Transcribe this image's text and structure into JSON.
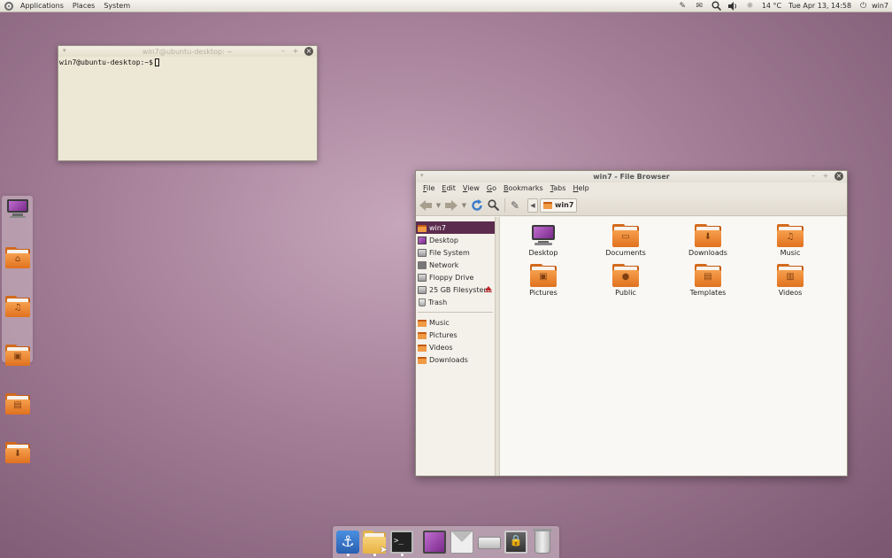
{
  "top_panel": {
    "menus": [
      "Applications",
      "Places",
      "System"
    ],
    "weather": "14 °C",
    "clock": "Tue Apr 13, 14:58",
    "user": "win7",
    "tray_icons": [
      "pencil-icon",
      "mail-icon",
      "search-icon",
      "volume-icon",
      "sun-icon",
      "power-icon"
    ]
  },
  "terminal": {
    "title": "win7@ubuntu-desktop: ~",
    "prompt": "win7@ubuntu-desktop:~$"
  },
  "file_browser": {
    "title": "win7 - File Browser",
    "menu": [
      "File",
      "Edit",
      "View",
      "Go",
      "Bookmarks",
      "Tabs",
      "Help"
    ],
    "menu_mnemonics": [
      "F",
      "E",
      "V",
      "G",
      "B",
      "T",
      "H"
    ],
    "path_crumb": "win7",
    "sidebar": {
      "places": [
        {
          "label": "win7",
          "icon": "home-icon",
          "selected": true
        },
        {
          "label": "Desktop",
          "icon": "desktop-icon"
        },
        {
          "label": "File System",
          "icon": "drive-icon"
        },
        {
          "label": "Network",
          "icon": "network-icon"
        },
        {
          "label": "Floppy Drive",
          "icon": "floppy-icon"
        },
        {
          "label": "25 GB Filesystem",
          "icon": "drive-icon",
          "ejectable": true
        },
        {
          "label": "Trash",
          "icon": "trash-icon"
        }
      ],
      "bookmarks": [
        {
          "label": "Music",
          "icon": "music-folder-icon"
        },
        {
          "label": "Pictures",
          "icon": "pictures-folder-icon"
        },
        {
          "label": "Videos",
          "icon": "videos-folder-icon"
        },
        {
          "label": "Downloads",
          "icon": "downloads-folder-icon"
        }
      ]
    },
    "items": [
      {
        "label": "Desktop",
        "icon": "desktop-icon"
      },
      {
        "label": "Documents",
        "icon": "documents-folder-icon"
      },
      {
        "label": "Downloads",
        "icon": "downloads-folder-icon"
      },
      {
        "label": "Music",
        "icon": "music-folder-icon"
      },
      {
        "label": "Pictures",
        "icon": "pictures-folder-icon"
      },
      {
        "label": "Public",
        "icon": "public-folder-icon"
      },
      {
        "label": "Templates",
        "icon": "templates-folder-icon"
      },
      {
        "label": "Videos",
        "icon": "videos-folder-icon"
      }
    ]
  },
  "side_dock": [
    "desktop-icon",
    "home-folder-icon",
    "music-folder-icon",
    "pictures-folder-icon",
    "videos-folder-icon",
    "downloads-folder-icon"
  ],
  "bottom_dock": [
    "anchor-icon",
    "file-manager-icon",
    "terminal-icon",
    "desktop-icon",
    "mail-icon",
    "drive-icon",
    "lock-screen-icon",
    "trash-icon"
  ],
  "colors": {
    "accent": "#5c2c4e",
    "folder_orange": "#f19a44",
    "eject_red": "#c0282d"
  }
}
